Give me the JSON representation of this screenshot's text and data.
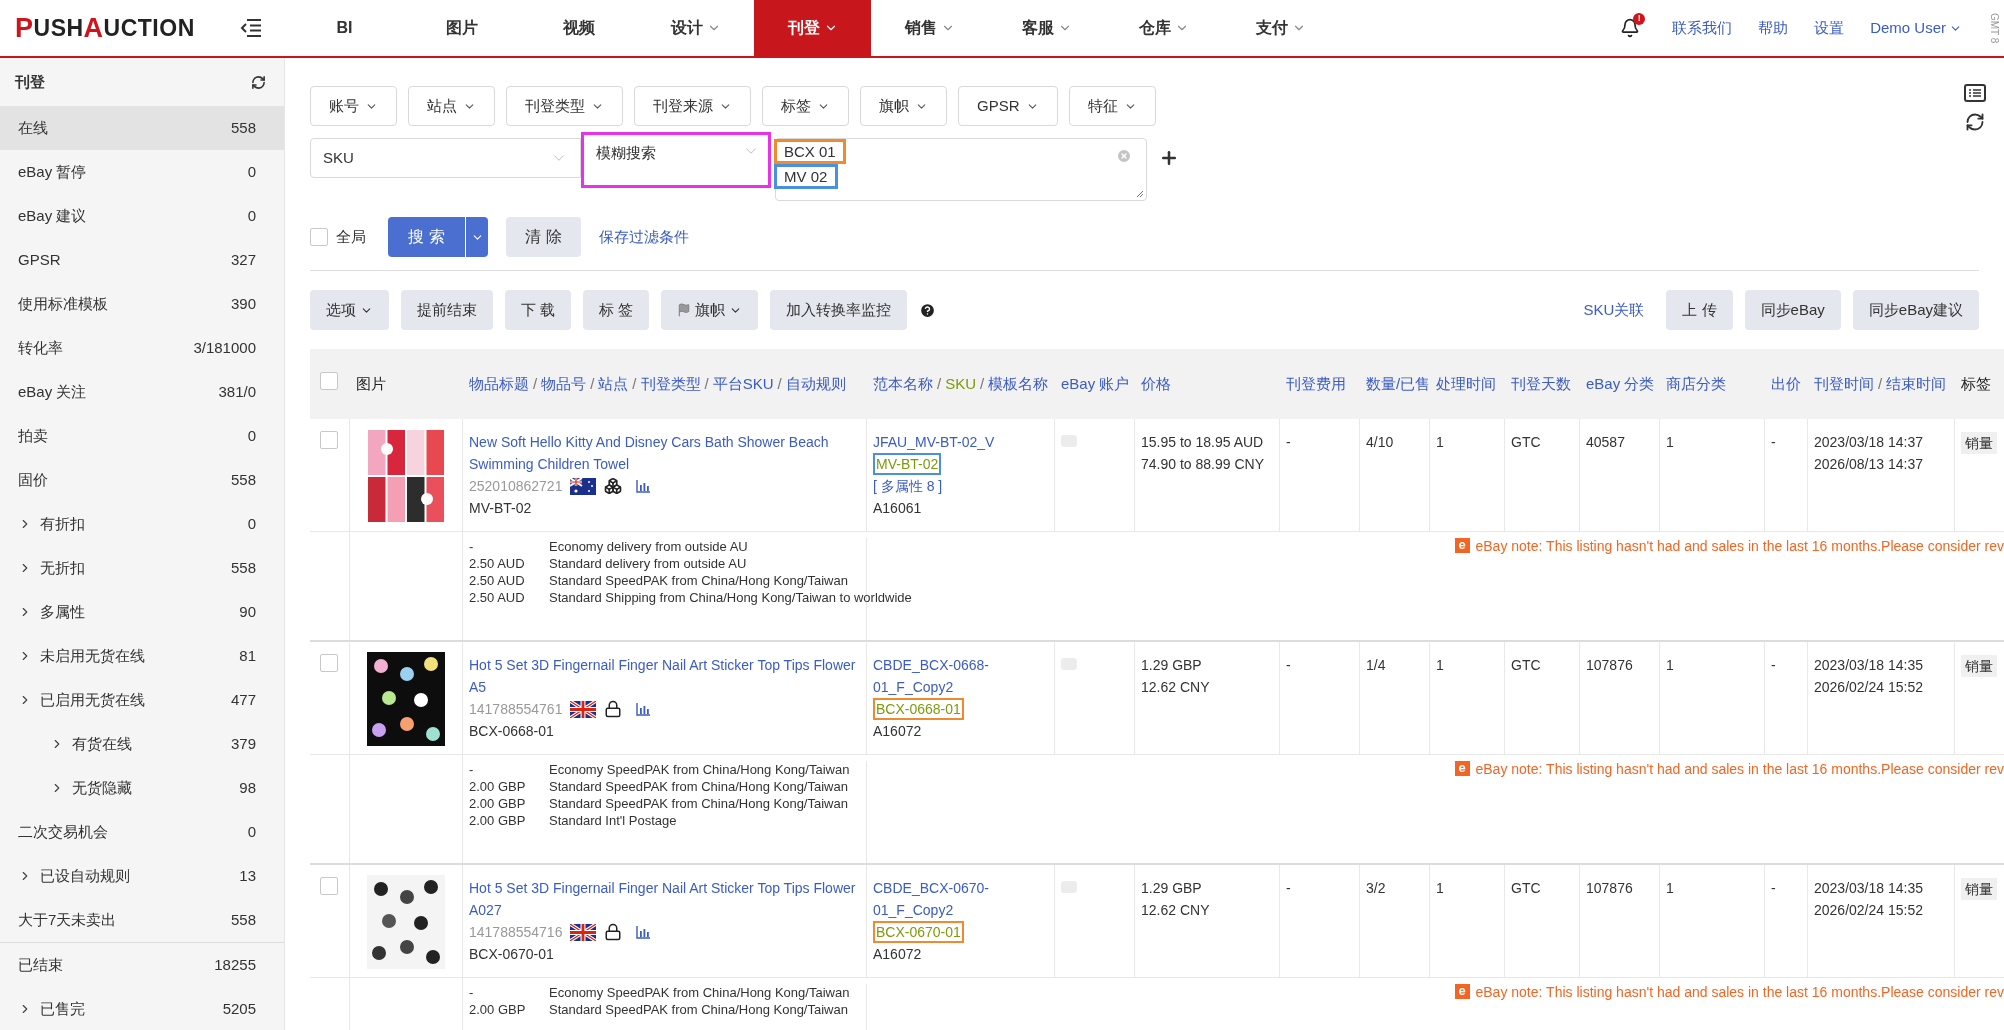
{
  "logo": {
    "parts": [
      {
        "text": "P",
        "accent": true
      },
      {
        "text": "USH",
        "accent": false
      },
      {
        "text": "A",
        "accent": true
      },
      {
        "text": "UCTION",
        "accent": false
      }
    ]
  },
  "nav": [
    {
      "label": "BI",
      "dropdown": false,
      "selected": false
    },
    {
      "label": "图片",
      "dropdown": false,
      "selected": false
    },
    {
      "label": "视频",
      "dropdown": false,
      "selected": false
    },
    {
      "label": "设计",
      "dropdown": true,
      "selected": false
    },
    {
      "label": "刊登",
      "dropdown": true,
      "selected": true
    },
    {
      "label": "销售",
      "dropdown": true,
      "selected": false
    },
    {
      "label": "客服",
      "dropdown": true,
      "selected": false
    },
    {
      "label": "仓库",
      "dropdown": true,
      "selected": false
    },
    {
      "label": "支付",
      "dropdown": true,
      "selected": false
    }
  ],
  "top_right": {
    "notification_badge": "!",
    "links": [
      "联系我们",
      "帮助",
      "设置"
    ],
    "user": "Demo User",
    "timezone": "GMT 8"
  },
  "sidebar": {
    "title": "刊登",
    "groups": [
      [
        {
          "label": "在线",
          "count": "558",
          "selected": true,
          "expandable": false
        },
        {
          "label": "eBay 暂停",
          "count": "0",
          "selected": false,
          "expandable": false
        },
        {
          "label": "eBay 建议",
          "count": "0",
          "selected": false,
          "expandable": false
        },
        {
          "label": "GPSR",
          "count": "327",
          "selected": false,
          "expandable": false
        },
        {
          "label": "使用标准模板",
          "count": "390",
          "selected": false,
          "expandable": false
        },
        {
          "label": "转化率",
          "count": "3/181000",
          "selected": false,
          "expandable": false
        },
        {
          "label": "eBay 关注",
          "count": "381/0",
          "selected": false,
          "expandable": false
        },
        {
          "label": "拍卖",
          "count": "0",
          "selected": false,
          "expandable": false
        },
        {
          "label": "固价",
          "count": "558",
          "selected": false,
          "expandable": false
        },
        {
          "label": "有折扣",
          "count": "0",
          "selected": false,
          "expandable": true
        },
        {
          "label": "无折扣",
          "count": "558",
          "selected": false,
          "expandable": true
        },
        {
          "label": "多属性",
          "count": "90",
          "selected": false,
          "expandable": true
        },
        {
          "label": "未启用无货在线",
          "count": "81",
          "selected": false,
          "expandable": true
        },
        {
          "label": "已启用无货在线",
          "count": "477",
          "selected": false,
          "expandable": true,
          "children": [
            {
              "label": "有货在线",
              "count": "379",
              "selected": false,
              "expandable": true
            },
            {
              "label": "无货隐藏",
              "count": "98",
              "selected": false,
              "expandable": true
            }
          ]
        },
        {
          "label": "二次交易机会",
          "count": "0",
          "selected": false,
          "expandable": false
        },
        {
          "label": "已设自动规则",
          "count": "13",
          "selected": false,
          "expandable": true
        },
        {
          "label": "大于7天未卖出",
          "count": "558",
          "selected": false,
          "expandable": false
        }
      ],
      [
        {
          "label": "已结束",
          "count": "18255",
          "selected": false,
          "expandable": false
        },
        {
          "label": "已售完",
          "count": "5205",
          "selected": false,
          "expandable": true
        }
      ]
    ]
  },
  "filters": [
    "账号",
    "站点",
    "刊登类型",
    "刊登来源",
    "标签",
    "旗帜",
    "GPSR",
    "特征"
  ],
  "search": {
    "field": "SKU",
    "match": {
      "value": "模糊搜索",
      "color": "#e831e8"
    },
    "values": [
      {
        "text": "BCX 01",
        "color": "#f08a2c"
      },
      {
        "text": "MV 02",
        "color": "#4a90e2"
      }
    ],
    "global": {
      "label": "全局",
      "checked": false
    },
    "search_button": "搜 索",
    "clear_button": "清 除",
    "save_link": "保存过滤条件"
  },
  "toolbar": {
    "left": [
      {
        "label": "选项",
        "kind": "dropdown"
      },
      {
        "label": "提前结束",
        "kind": "button"
      },
      {
        "label": "下 载",
        "kind": "button"
      },
      {
        "label": "标 签",
        "kind": "button"
      },
      {
        "label": "旗帜",
        "kind": "flag"
      },
      {
        "label": "加入转换率监控",
        "kind": "button"
      }
    ],
    "link": "SKU关联",
    "right": [
      "上 传",
      "同步eBay",
      "同步eBay建议"
    ]
  },
  "table": {
    "select_all": {
      "checked": false
    },
    "columns": [
      {
        "parts": [
          {
            "text": "图片",
            "kind": "plain"
          }
        ]
      },
      {
        "parts": [
          {
            "text": "物品标题",
            "kind": "link"
          },
          {
            "text": "/",
            "kind": "sep"
          },
          {
            "text": "物品号",
            "kind": "link"
          },
          {
            "text": "/",
            "kind": "sep"
          },
          {
            "text": "站点",
            "kind": "link"
          },
          {
            "text": "/",
            "kind": "sep"
          },
          {
            "text": "刊登类型",
            "kind": "link"
          },
          {
            "text": "/",
            "kind": "sep"
          },
          {
            "text": "平台SKU",
            "kind": "link"
          },
          {
            "text": "/",
            "kind": "sep"
          },
          {
            "text": "自动规则",
            "kind": "link"
          }
        ]
      },
      {
        "parts": [
          {
            "text": "范本名称",
            "kind": "link"
          },
          {
            "text": "/",
            "kind": "sep"
          },
          {
            "text": "SKU",
            "kind": "sku"
          },
          {
            "text": "/",
            "kind": "sep"
          },
          {
            "text": "模板名称",
            "kind": "link"
          }
        ]
      },
      {
        "parts": [
          {
            "text": "eBay 账户",
            "kind": "link"
          }
        ]
      },
      {
        "parts": [
          {
            "text": "价格",
            "kind": "link"
          }
        ]
      },
      {
        "parts": [
          {
            "text": "刊登费用",
            "kind": "link"
          }
        ]
      },
      {
        "parts": [
          {
            "text": "数量/已售",
            "kind": "link"
          }
        ]
      },
      {
        "parts": [
          {
            "text": "处理时间",
            "kind": "link"
          }
        ]
      },
      {
        "parts": [
          {
            "text": "刊登天数",
            "kind": "link"
          }
        ]
      },
      {
        "parts": [
          {
            "text": "eBay 分类",
            "kind": "link"
          }
        ]
      },
      {
        "parts": [
          {
            "text": "商店分类",
            "kind": "link"
          }
        ]
      },
      {
        "parts": [
          {
            "text": "出价",
            "kind": "link"
          }
        ]
      },
      {
        "parts": [
          {
            "text": "刊登时间",
            "kind": "link"
          },
          {
            "text": "/",
            "kind": "sep"
          },
          {
            "text": "结束时间",
            "kind": "link"
          }
        ]
      },
      {
        "parts": [
          {
            "text": "标签",
            "kind": "plain"
          }
        ]
      }
    ],
    "rows": [
      {
        "checked": false,
        "title": "New Soft Hello Kitty And Disney Cars Bath Shower Beach Swimming Children Towel",
        "item_no": "252010862721",
        "flag": {
          "kind": "au"
        },
        "badge": {
          "kind": "boxes"
        },
        "platform_sku": "MV-BT-02",
        "template": "JFAU_MV-BT-02_V",
        "sku": {
          "text": "MV-BT-02",
          "color": "#4a90e2"
        },
        "variants": "[ 多属性 8 ]",
        "template_id": "A16061",
        "prices": [
          "15.95 to 18.95 AUD",
          "74.90 to 88.99 CNY"
        ],
        "fee": "-",
        "quantity": "4/10",
        "handling": "1",
        "duration": "GTC",
        "category": "40587",
        "store_category": "1",
        "bid": "-",
        "times": [
          "2023/03/18 14:37",
          "2026/08/13 14:37"
        ],
        "tag": "销量",
        "shipping": [
          {
            "cost": "-",
            "service": "Economy delivery from outside AU"
          },
          {
            "cost": "2.50 AUD",
            "service": "Standard delivery from outside AU"
          },
          {
            "cost": "2.50 AUD",
            "service": "Standard SpeedPAK from China/Hong Kong/Taiwan"
          },
          {
            "cost": "2.50 AUD",
            "service": "Standard Shipping from China/Hong Kong/Taiwan to worldwide"
          }
        ],
        "note": {
          "badge": "e",
          "text": "eBay note: This listing hasn't had and sales in the last 16 months.Please consider rev"
        }
      },
      {
        "checked": false,
        "title": "Hot 5 Set 3D Fingernail Finger Nail Art Sticker Top Tips Flower A5",
        "item_no": "141788554761",
        "flag": {
          "kind": "uk"
        },
        "badge": {
          "kind": "lock"
        },
        "platform_sku": "BCX-0668-01",
        "template": "CBDE_BCX-0668-01_F_Copy2",
        "sku": {
          "text": "BCX-0668-01",
          "color": "#f08a2c"
        },
        "template_id": "A16072",
        "prices": [
          "1.29 GBP",
          "12.62 CNY"
        ],
        "fee": "-",
        "quantity": "1/4",
        "handling": "1",
        "duration": "GTC",
        "category": "107876",
        "store_category": "1",
        "bid": "-",
        "times": [
          "2023/03/18 14:35",
          "2026/02/24 15:52"
        ],
        "tag": "销量",
        "shipping": [
          {
            "cost": "-",
            "service": "Economy SpeedPAK from China/Hong Kong/Taiwan"
          },
          {
            "cost": "2.00 GBP",
            "service": "Standard SpeedPAK from China/Hong Kong/Taiwan"
          },
          {
            "cost": "2.00 GBP",
            "service": "Standard SpeedPAK from China/Hong Kong/Taiwan"
          },
          {
            "cost": "2.00 GBP",
            "service": "Standard Int'l Postage"
          }
        ],
        "note": {
          "badge": "e",
          "text": "eBay note: This listing hasn't had and sales in the last 16 months.Please consider rev"
        }
      },
      {
        "checked": false,
        "title": "Hot 5 Set 3D Fingernail Finger Nail Art Sticker Top Tips Flower A027",
        "item_no": "141788554716",
        "flag": {
          "kind": "uk"
        },
        "badge": {
          "kind": "lock"
        },
        "platform_sku": "BCX-0670-01",
        "template": "CBDE_BCX-0670-01_F_Copy2",
        "sku": {
          "text": "BCX-0670-01",
          "color": "#f08a2c"
        },
        "template_id": "A16072",
        "prices": [
          "1.29 GBP",
          "12.62 CNY"
        ],
        "fee": "-",
        "quantity": "3/2",
        "handling": "1",
        "duration": "GTC",
        "category": "107876",
        "store_category": "1",
        "bid": "-",
        "times": [
          "2023/03/18 14:35",
          "2026/02/24 15:52"
        ],
        "tag": "销量",
        "shipping": [
          {
            "cost": "-",
            "service": "Economy SpeedPAK from China/Hong Kong/Taiwan"
          },
          {
            "cost": "2.00 GBP",
            "service": "Standard SpeedPAK from China/Hong Kong/Taiwan"
          }
        ],
        "note": {
          "badge": "e",
          "text": "eBay note: This listing hasn't had and sales in the last 16 months.Please consider rev"
        }
      }
    ]
  }
}
